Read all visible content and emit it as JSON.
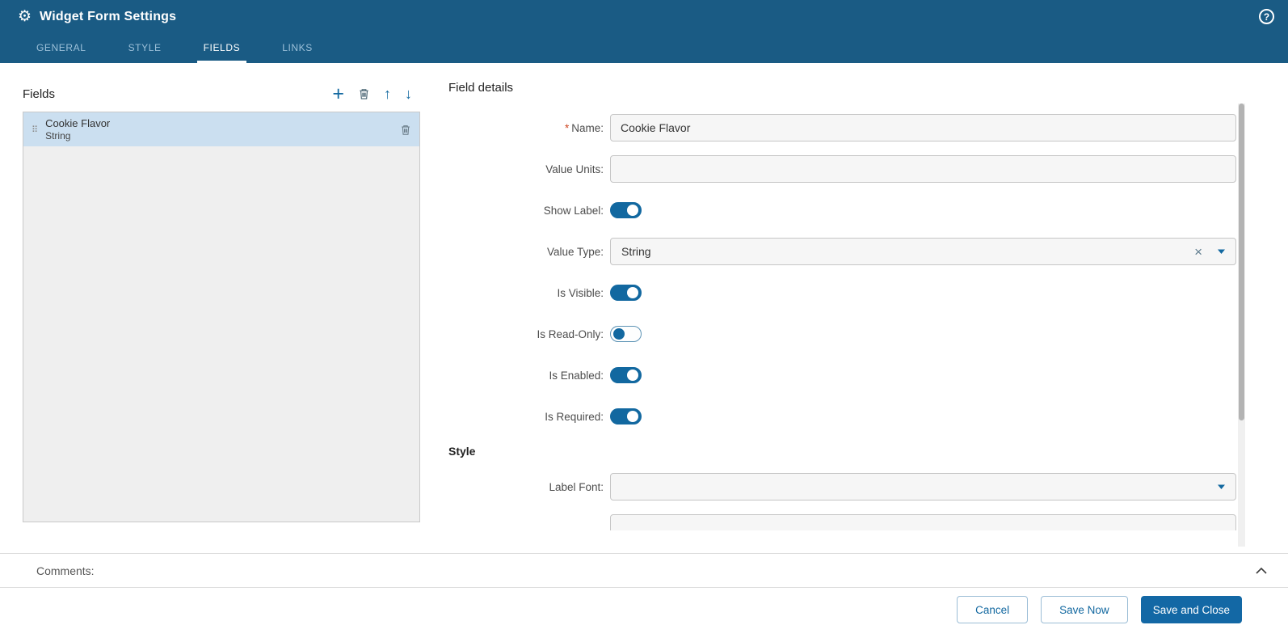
{
  "colors": {
    "header_bg": "#1a5b84",
    "accent": "#1268a0",
    "selected_item_bg": "#cbdff0"
  },
  "icons": {
    "gear": "⚙",
    "help": "?",
    "add": "+",
    "up": "↑",
    "down": "↓",
    "drag": "⠿",
    "clear": "×",
    "required": "*"
  },
  "header": {
    "title": "Widget Form Settings",
    "tabs": [
      {
        "label": "GENERAL",
        "active": false
      },
      {
        "label": "STYLE",
        "active": false
      },
      {
        "label": "FIELDS",
        "active": true
      },
      {
        "label": "LINKS",
        "active": false
      }
    ]
  },
  "fields_panel": {
    "title": "Fields",
    "items": [
      {
        "name": "Cookie Flavor",
        "type": "String",
        "selected": true
      }
    ]
  },
  "details_panel": {
    "title": "Field details",
    "rows": {
      "name": {
        "label": "Name:",
        "required": true,
        "value": "Cookie Flavor"
      },
      "value_units": {
        "label": "Value Units:",
        "value": ""
      },
      "show_label": {
        "label": "Show Label:",
        "on": true
      },
      "value_type": {
        "label": "Value Type:",
        "value": "String"
      },
      "is_visible": {
        "label": "Is Visible:",
        "on": true
      },
      "is_read_only": {
        "label": "Is Read-Only:",
        "on": false
      },
      "is_enabled": {
        "label": "Is Enabled:",
        "on": true
      },
      "is_required": {
        "label": "Is Required:",
        "on": true
      }
    },
    "style_section": {
      "title": "Style",
      "label_font": {
        "label": "Label Font:",
        "value": ""
      }
    }
  },
  "comments": {
    "label": "Comments:"
  },
  "footer": {
    "cancel": "Cancel",
    "save_now": "Save Now",
    "save_and_close": "Save and Close"
  }
}
